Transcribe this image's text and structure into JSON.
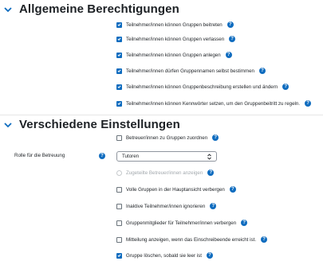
{
  "section1": {
    "title": "Allgemeine Berechtigungen",
    "options": [
      {
        "label": "Teilnehmer/innen können Gruppen beitreten",
        "checked": true
      },
      {
        "label": "Teilnehmer/innen können Gruppen verlassen",
        "checked": true
      },
      {
        "label": "Teilnehmer/innen können Gruppen anlegen",
        "checked": true
      },
      {
        "label": "Teilnehmer/innen dürfen Gruppennamen selbst bestimmen",
        "checked": true
      },
      {
        "label": "Teilnehmer/innen können Gruppenbeschreibung erstellen und ändern",
        "checked": true
      },
      {
        "label": "Teilnehmer/innen können Kennwörter setzen, um den Gruppenbeitritt zu regeln.",
        "checked": true
      }
    ]
  },
  "section2": {
    "title": "Verschiedene Einstellungen",
    "assign_tutors": {
      "label": "Betreuer/innen zu Gruppen zuordnen",
      "checked": false
    },
    "tutor_role": {
      "label": "Rolle für die Betreuung",
      "value": "Tutoren"
    },
    "show_tutors": {
      "label": "Zugeteilte Betreuer/innen anzeigen",
      "disabled": true
    },
    "options": [
      {
        "label": "Volle Gruppen in der Hauptansicht verbergen",
        "checked": false
      },
      {
        "label": "Inaktive Teilnehmer/innen ignorieren",
        "checked": false
      },
      {
        "label": "Gruppenmitglieder für Teilnehmer/innen verbergen",
        "checked": false
      },
      {
        "label": "Mitteilung anzeigen, wenn das Einschreibeende erreicht ist.",
        "checked": false
      },
      {
        "label": "Gruppe löschen, sobald sie leer ist",
        "checked": true
      }
    ]
  },
  "help_glyph": "?",
  "colors": {
    "accent": "#0f6cbf",
    "text": "#1d2125",
    "disabled": "#a3a9ae"
  }
}
